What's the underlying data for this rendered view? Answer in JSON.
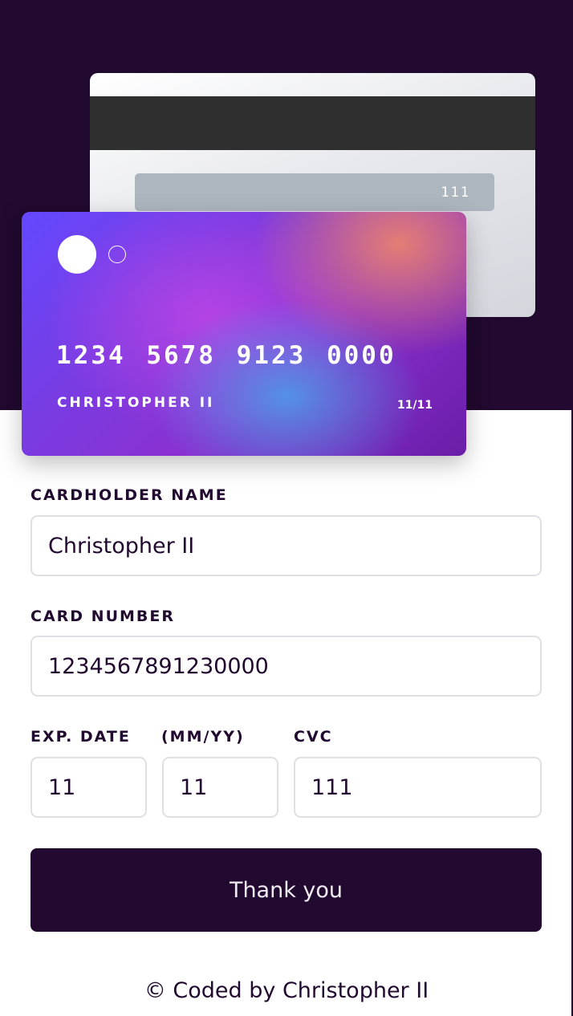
{
  "card": {
    "back_cvc": "111",
    "number": "1234 5678 9123 0000",
    "name": "CHRISTOPHER II",
    "expiry": "11/11"
  },
  "form": {
    "cardholder_label": "CARDHOLDER NAME",
    "cardholder_value": "Christopher II",
    "number_label": "CARD NUMBER",
    "number_value": "1234567891230000",
    "exp_label": "EXP. DATE",
    "exp_format_label": "(MM/YY)",
    "cvc_label": "CVC",
    "month_value": "11",
    "year_value": "11",
    "cvc_value": "111",
    "submit_label": "Thank you"
  },
  "footer": {
    "text": "© Coded by Christopher II"
  },
  "colors": {
    "primary": "#21092f",
    "border": "#e0dfe4",
    "background": "#ffffff"
  }
}
